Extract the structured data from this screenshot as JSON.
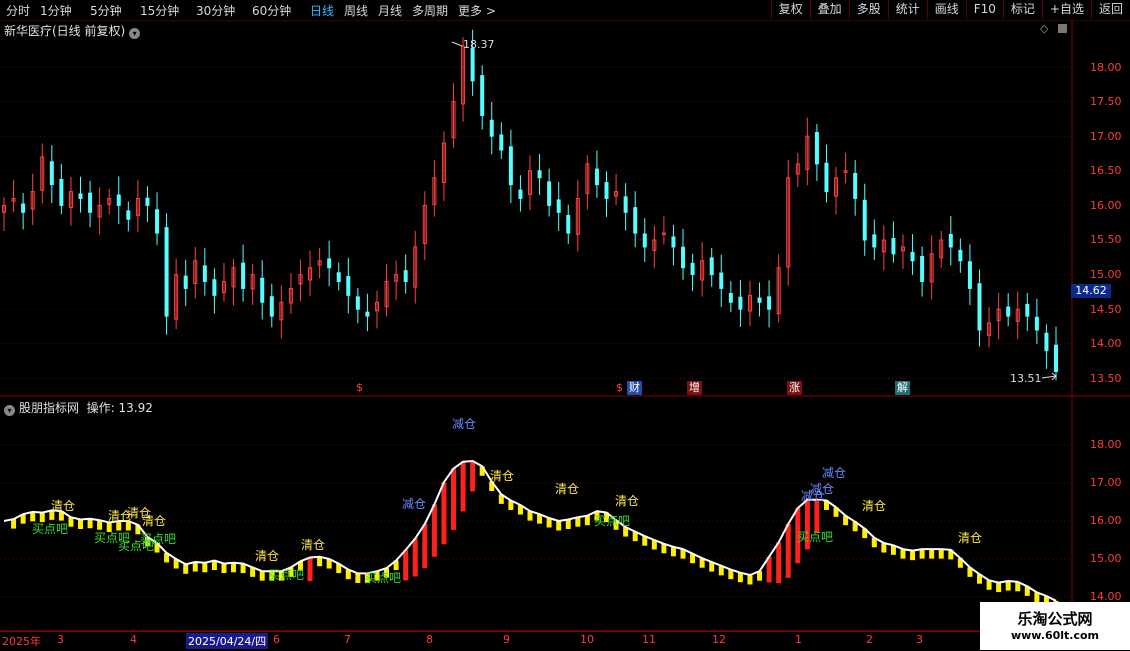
{
  "toolbar": {
    "periods": [
      "分时",
      "1分钟",
      "5分钟",
      "15分钟",
      "30分钟",
      "60分钟",
      "日线",
      "周线",
      "月线",
      "多周期",
      "更多 >"
    ],
    "active_period": "日线",
    "tools": [
      "复权",
      "叠加",
      "多股",
      "统计",
      "画线",
      "F10",
      "标记",
      "+自选",
      "返回"
    ]
  },
  "main_chart": {
    "title": "新华医疗(日线 前复权)",
    "high_label": "18.37",
    "low_label": "13.51",
    "current_price": "14.62",
    "y_ticks": [
      "18.00",
      "17.50",
      "17.00",
      "16.50",
      "16.00",
      "15.50",
      "15.00",
      "14.50",
      "14.00",
      "13.50"
    ],
    "events": [
      {
        "text": "$",
        "style": "dollar"
      },
      {
        "text": "$",
        "style": "dollar"
      },
      {
        "text": "财",
        "style": "blue"
      },
      {
        "text": "增",
        "style": "red"
      },
      {
        "text": "涨",
        "style": "red"
      },
      {
        "text": "解",
        "style": "teal"
      }
    ]
  },
  "indicator": {
    "title": "股朋指标网",
    "op_label": "操作: 13.92",
    "y_ticks": [
      "18.00",
      "17.00",
      "16.00",
      "15.00",
      "14.00"
    ],
    "signals": {
      "clear": "清仓",
      "buy": "买点吧",
      "reduce": "减仓"
    }
  },
  "x_axis": {
    "labels": [
      "2025年",
      "3",
      "4",
      "2025/04/24/四",
      "6",
      "7",
      "8",
      "9",
      "10",
      "11",
      "12",
      "1",
      "2",
      "3"
    ],
    "selected": "2025/04/24/四"
  },
  "watermark": {
    "name": "乐淘公式网",
    "url": "www.60lt.com"
  },
  "colors": {
    "up": "#ff4040",
    "down": "#54ffff",
    "axis": "#8a0000",
    "clear_signal": "#ffe84a",
    "buy_signal": "#33dd33",
    "reduce_signal": "#6a8cff"
  },
  "chart_data": {
    "type": "candlestick",
    "y_range": [
      13.4,
      18.5
    ],
    "close_series": [
      16.0,
      16.1,
      15.9,
      16.2,
      16.7,
      16.3,
      16.0,
      16.2,
      16.1,
      15.9,
      16.0,
      16.1,
      16.0,
      15.8,
      16.1,
      16.0,
      15.6,
      14.4,
      15.0,
      14.8,
      15.2,
      14.9,
      14.7,
      14.9,
      15.1,
      14.8,
      15.0,
      14.6,
      14.4,
      14.6,
      14.8,
      15.0,
      15.1,
      15.2,
      15.1,
      14.9,
      14.7,
      14.5,
      14.4,
      14.6,
      14.9,
      15.0,
      14.9,
      15.4,
      16.0,
      16.4,
      16.9,
      17.5,
      18.3,
      17.8,
      17.3,
      17.0,
      16.8,
      16.3,
      16.1,
      16.5,
      16.4,
      16.0,
      15.9,
      15.6,
      16.1,
      16.6,
      16.3,
      16.1,
      16.2,
      15.9,
      15.6,
      15.4,
      15.5,
      15.6,
      15.4,
      15.1,
      15.0,
      15.2,
      15.0,
      14.8,
      14.6,
      14.5,
      14.7,
      14.6,
      14.5,
      15.1,
      16.4,
      16.6,
      17.0,
      16.6,
      16.2,
      16.4,
      16.5,
      16.1,
      15.5,
      15.4,
      15.5,
      15.3,
      15.4,
      15.2,
      14.9,
      15.3,
      15.5,
      15.4,
      15.2,
      14.8,
      14.2,
      14.3,
      14.5,
      14.4,
      14.5,
      14.4,
      14.2,
      13.9,
      13.6
    ]
  }
}
